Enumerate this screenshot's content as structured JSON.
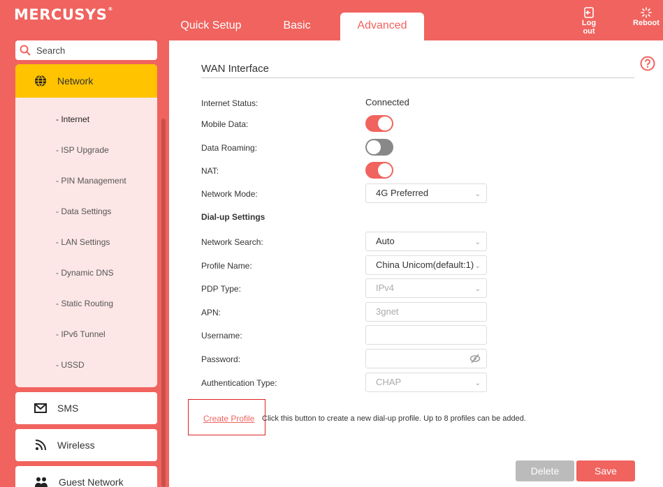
{
  "header": {
    "logo": "MERCUSYS",
    "logo_mark": "®",
    "tabs": [
      "Quick Setup",
      "Basic",
      "Advanced"
    ],
    "logout_label": "Log out",
    "reboot_label": "Reboot"
  },
  "sidebar": {
    "search_placeholder": "Search",
    "network_label": "Network",
    "sub_items": [
      "- Internet",
      "- ISP Upgrade",
      "- PIN Management",
      "- Data Settings",
      "- LAN Settings",
      "- Dynamic DNS",
      "- Static Routing",
      "- IPv6 Tunnel",
      "- USSD"
    ],
    "sms_label": "SMS",
    "wireless_label": "Wireless",
    "guest_label": "Guest Network"
  },
  "main": {
    "title": "WAN Interface",
    "internet_status_label": "Internet Status:",
    "internet_status_value": "Connected",
    "mobile_data_label": "Mobile Data:",
    "mobile_data_on": true,
    "data_roaming_label": "Data Roaming:",
    "data_roaming_on": false,
    "nat_label": "NAT:",
    "nat_on": true,
    "network_mode_label": "Network Mode:",
    "network_mode_value": "4G Preferred",
    "dialup_heading": "Dial-up Settings",
    "network_search_label": "Network Search:",
    "network_search_value": "Auto",
    "profile_name_label": "Profile Name:",
    "profile_name_value": "China Unicom(default:1)",
    "pdp_type_label": "PDP Type:",
    "pdp_type_value": "IPv4",
    "apn_label": "APN:",
    "apn_value": "3gnet",
    "username_label": "Username:",
    "username_value": "",
    "password_label": "Password:",
    "password_value": "",
    "auth_type_label": "Authentication Type:",
    "auth_type_value": "CHAP",
    "create_profile_label": "Create Profile",
    "create_profile_hint": "Click this button to create a new dial-up profile. Up to 8 profiles can be added.",
    "delete_label": "Delete",
    "save_label": "Save"
  },
  "colors": {
    "brand": "#f0635e",
    "active_menu": "#ffc300",
    "submenu_bg": "#fde7e6"
  }
}
